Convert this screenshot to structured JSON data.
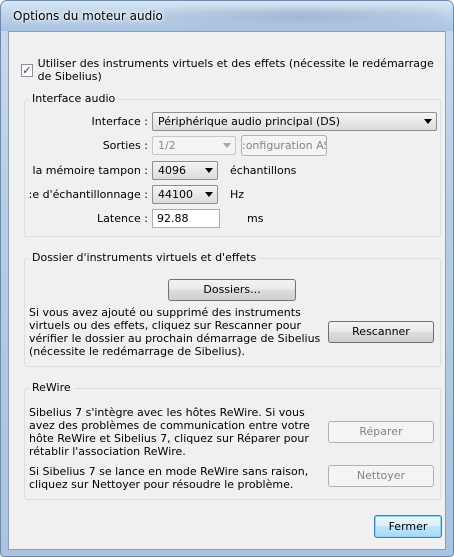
{
  "window": {
    "title": "Options du moteur audio"
  },
  "virtual_instruments": {
    "checked": true,
    "label": "Utiliser des instruments virtuels et des effets (nécessite le redémarrage de Sibelius)"
  },
  "audio_interface": {
    "group_title": "Interface audio",
    "interface_label": "Interface :",
    "interface_value": "Périphérique audio principal (DS)",
    "outputs_label": "Sorties :",
    "outputs_value": "1/2",
    "asio_button": ":onfiguration ASIO...",
    "buffer_label": "la mémoire tampon :",
    "buffer_value": "4096",
    "buffer_unit": "échantillons",
    "samplerate_label": ":e d'échantillonnage :",
    "samplerate_value": "44100",
    "samplerate_unit": "Hz",
    "latency_label": "Latence :",
    "latency_value": "92.88",
    "latency_unit": "ms"
  },
  "vi_folder": {
    "group_title": "Dossier d'instruments virtuels et d'effets",
    "folders_button": "Dossiers...",
    "description": "Si vous avez ajouté ou supprimé des instruments virtuels ou des effets, cliquez sur Rescanner pour vérifier le dossier au prochain démarrage de Sibelius (nécessite le redémarrage de Sibelius).",
    "rescan_button": "Rescanner"
  },
  "rewire": {
    "group_title": "ReWire",
    "description": "Sibelius 7 s'intègre avec les hôtes ReWire. Si vous avez des problèmes de communication entre votre hôte ReWire et Sibelius 7, cliquez sur Réparer pour rétablir l'association ReWire.",
    "repair_button": "Réparer",
    "clean_description": "Si Sibelius 7 se lance en mode ReWire sans raison, cliquez sur Nettoyer pour résoudre le problème.",
    "clean_button": "Nettoyer"
  },
  "footer": {
    "close_button": "Fermer"
  }
}
